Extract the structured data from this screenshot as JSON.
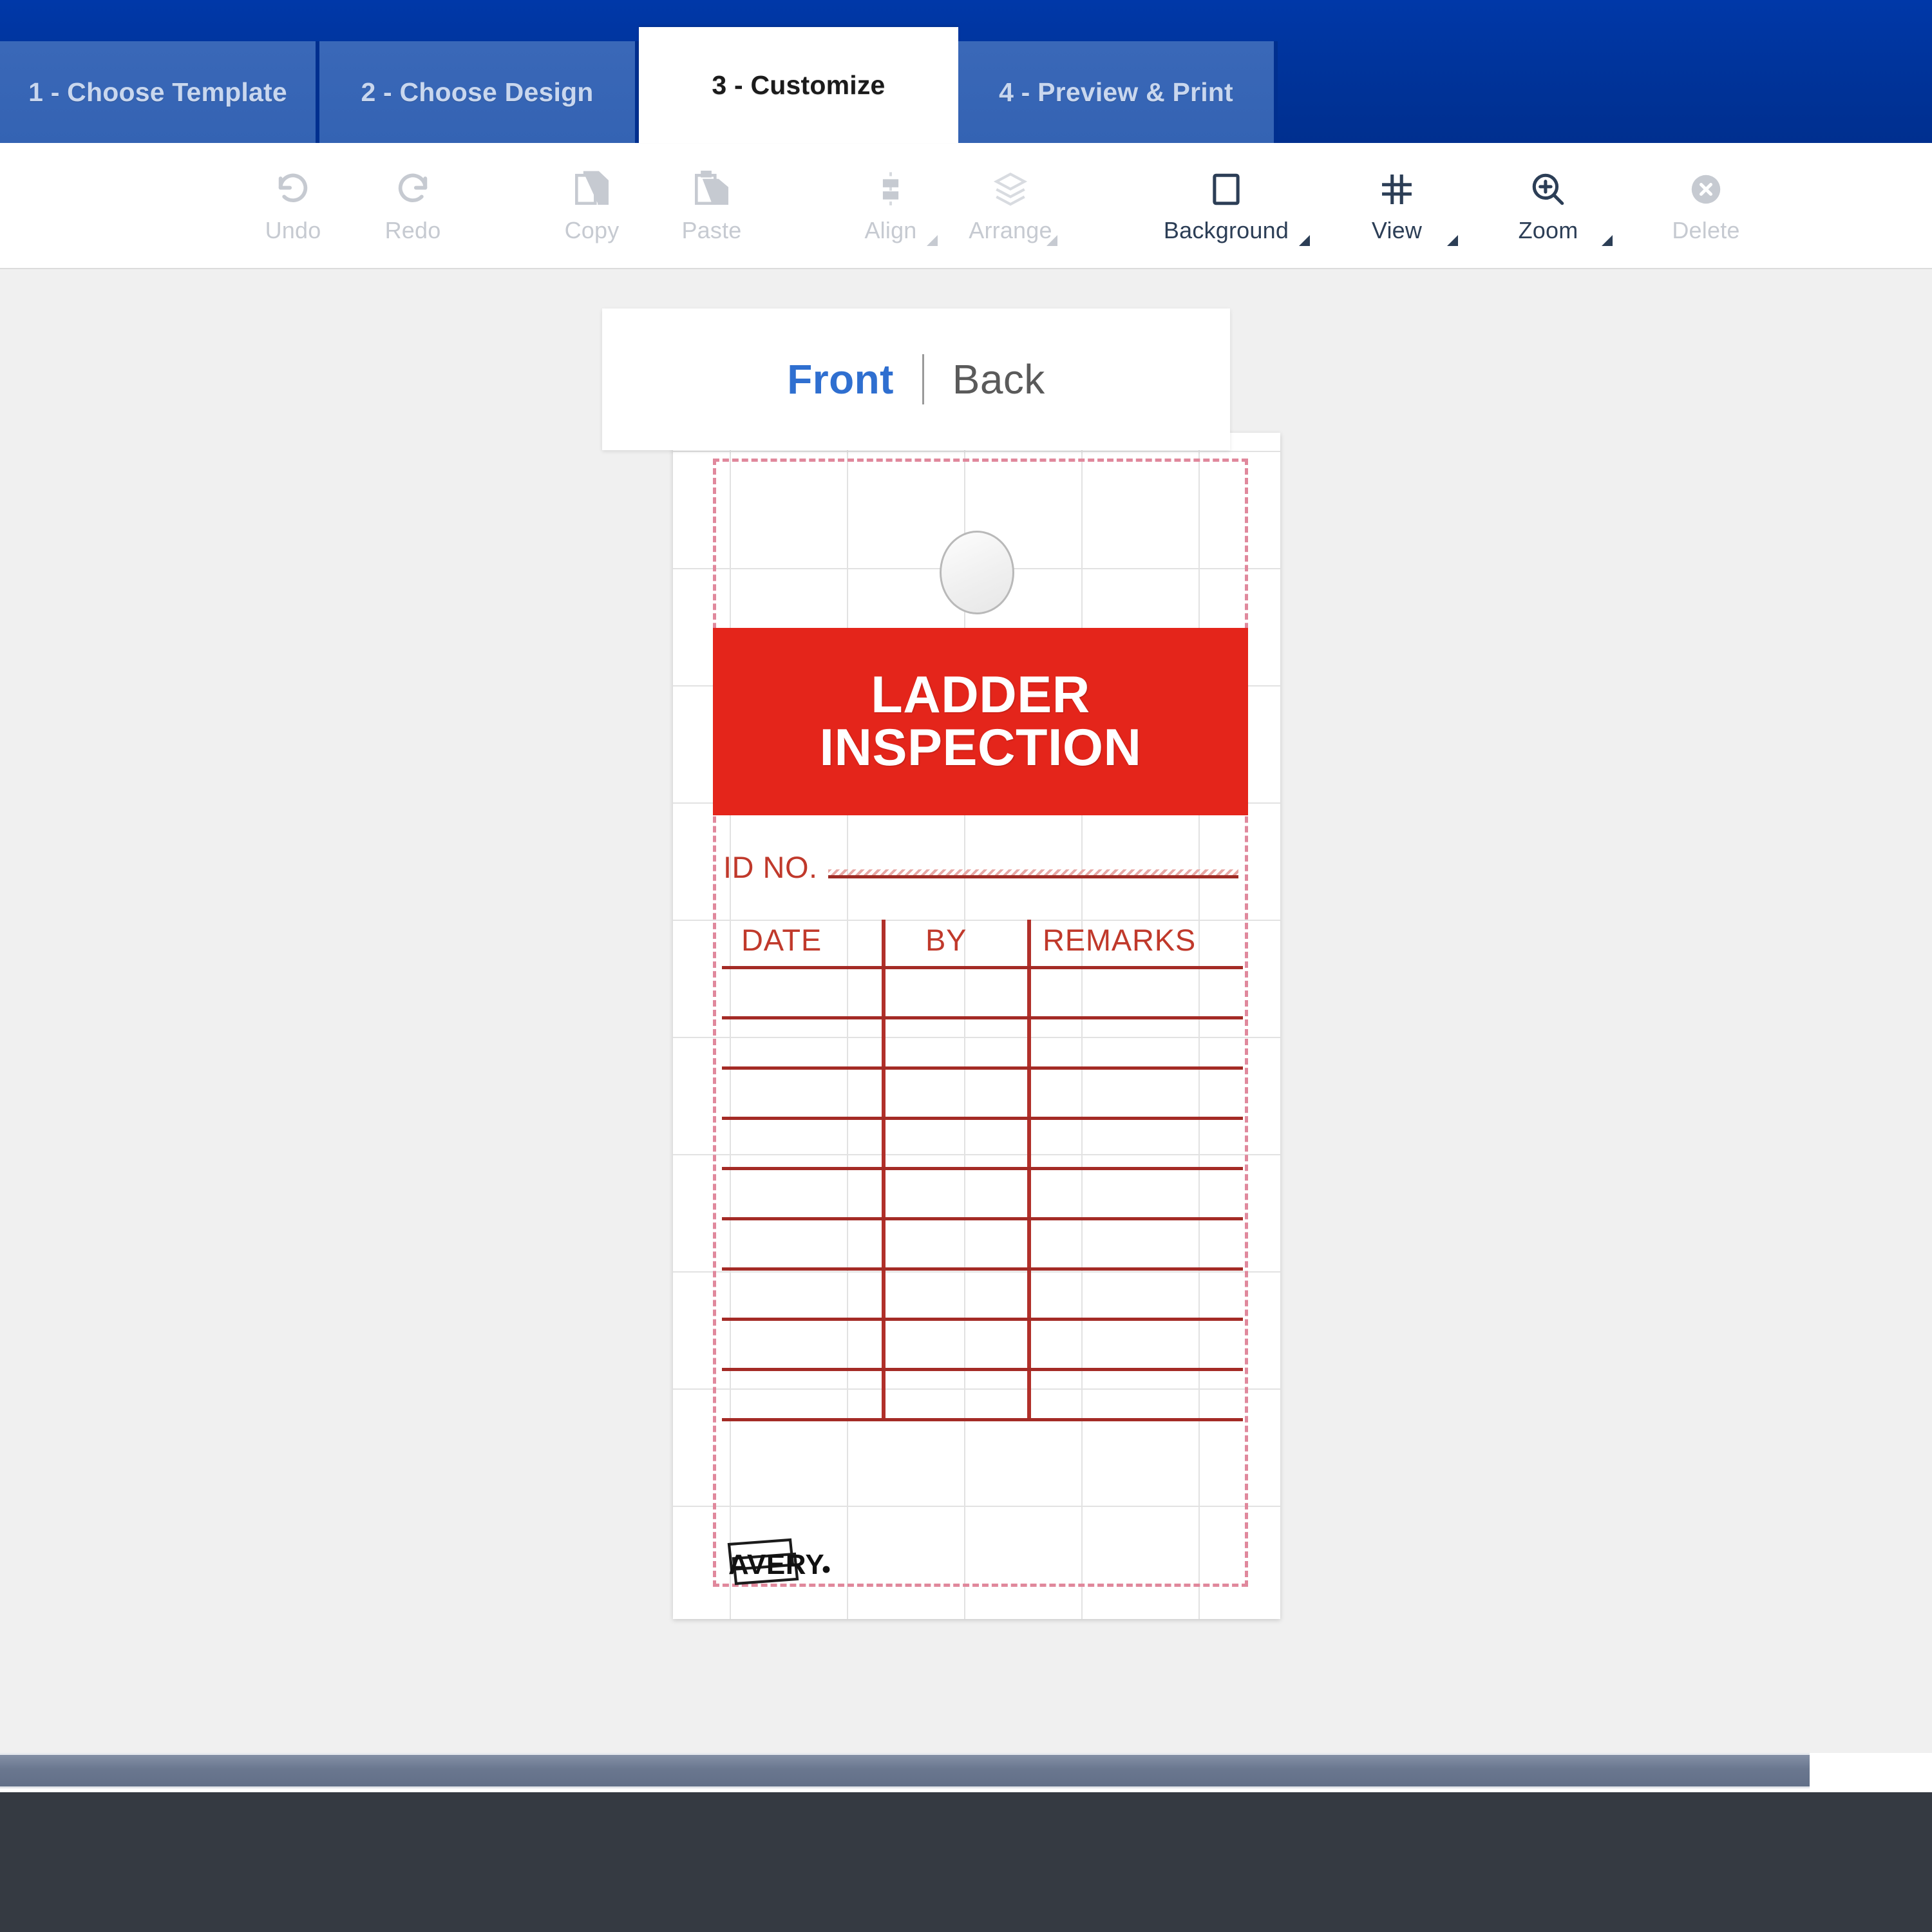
{
  "wizard": {
    "steps": [
      {
        "label": "1 - Choose Template",
        "active": false
      },
      {
        "label": "2 - Choose Design",
        "active": false
      },
      {
        "label": "3 - Customize",
        "active": true
      },
      {
        "label": "4 - Preview & Print",
        "active": false
      }
    ],
    "active_step_label": "3 - Customize"
  },
  "toolbar": {
    "items": [
      {
        "label": "Undo",
        "icon": "undo-arrow-icon",
        "disabled": true,
        "caret": false
      },
      {
        "label": "Redo",
        "icon": "redo-arrow-icon",
        "disabled": true,
        "caret": false
      },
      {
        "label": "Copy",
        "icon": "copy-pages-icon",
        "disabled": true,
        "caret": false
      },
      {
        "label": "Paste",
        "icon": "paste-clipboard-icon",
        "disabled": true,
        "caret": false
      },
      {
        "label": "Align",
        "icon": "align-center-icon",
        "disabled": true,
        "caret": true
      },
      {
        "label": "Arrange",
        "icon": "arrange-layers-icon",
        "disabled": true,
        "caret": true
      },
      {
        "label": "Background",
        "icon": "background-square-icon",
        "disabled": false,
        "caret": true
      },
      {
        "label": "View",
        "icon": "grid-view-icon",
        "disabled": false,
        "caret": true
      },
      {
        "label": "Zoom",
        "icon": "magnifier-plus-icon",
        "disabled": false,
        "caret": true
      },
      {
        "label": "Delete",
        "icon": "delete-circle-x-icon",
        "disabled": true,
        "caret": false
      }
    ]
  },
  "canvas": {
    "face_tabs": [
      {
        "label": "Front",
        "selected": true
      },
      {
        "label": "Back",
        "selected": false
      }
    ],
    "design": {
      "banner_line1": "LADDER",
      "banner_line2": "INSPECTION",
      "id_label": "ID NO.",
      "id_value": "",
      "columns": [
        "DATE",
        "BY",
        "REMARKS"
      ],
      "row_count": 10,
      "brand": "AVERY",
      "brand_mark": "®"
    }
  },
  "colors": {
    "nav_blue_dark": "#003399",
    "nav_blue_tab": "#3463b3",
    "active_tab_text": "#1b1b1b",
    "banner_red": "#e4251b",
    "rule_red": "#a42b26",
    "label_red": "#c0392b",
    "bleed_dashed": "#e0889c",
    "selected_tab_blue": "#2f6fd0",
    "stage_bg": "#f0f0f0",
    "footer_dark": "#353a42",
    "scrollbar": "#6a778f"
  }
}
